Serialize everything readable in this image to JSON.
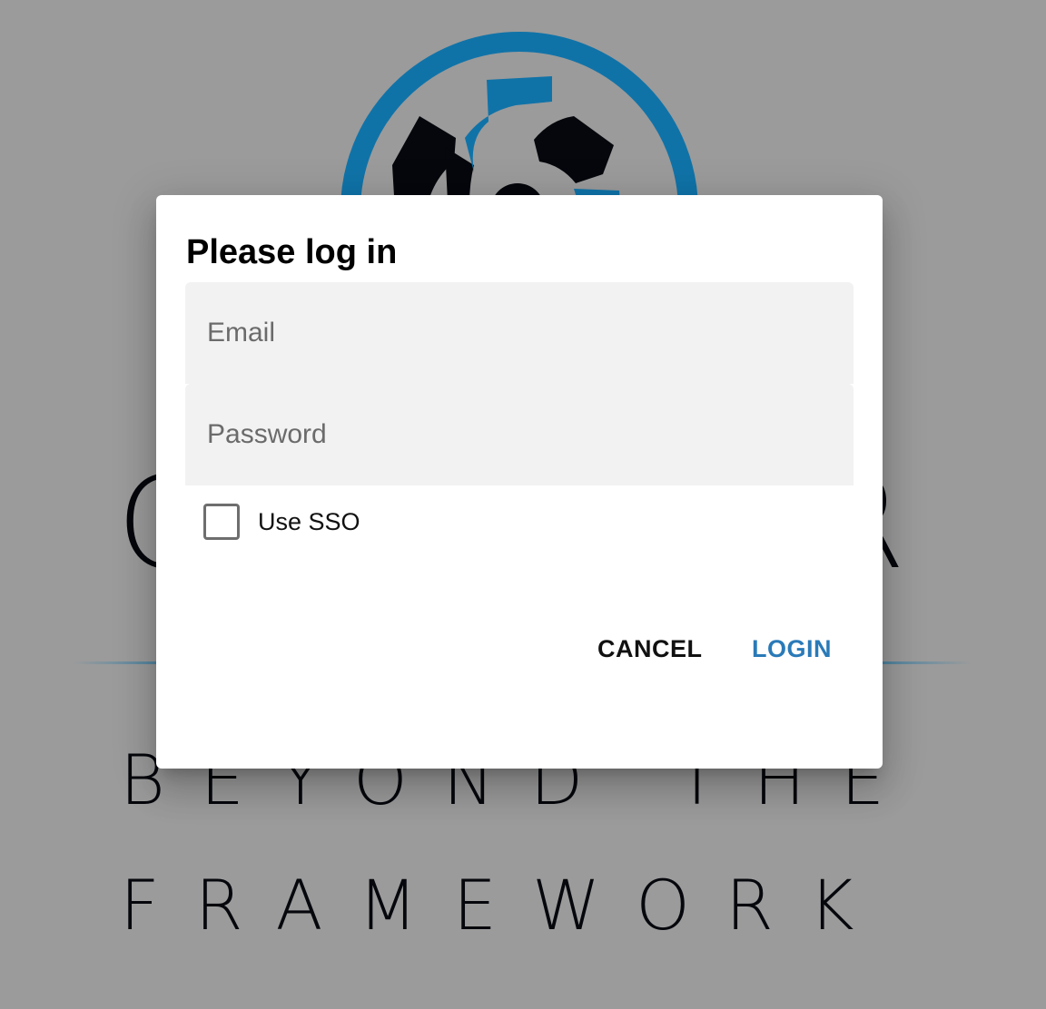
{
  "splash": {
    "brand_left": "C",
    "brand_right": "R",
    "tagline_line1": "BEYOND THE",
    "tagline_line2": "FRAMEWORK",
    "colors": {
      "backdrop": "#9b9b9b",
      "logo_blue": "#1073a8",
      "logo_dark": "#05070c"
    }
  },
  "dialog": {
    "title": "Please log in",
    "email": {
      "placeholder": "Email",
      "value": ""
    },
    "password": {
      "placeholder": "Password",
      "value": ""
    },
    "sso": {
      "label": "Use SSO",
      "checked": false
    },
    "buttons": {
      "cancel": "CANCEL",
      "login": "LOGIN"
    },
    "colors": {
      "surface": "#ffffff",
      "field_fill": "#f2f2f2",
      "primary": "#2a7ab8"
    }
  }
}
